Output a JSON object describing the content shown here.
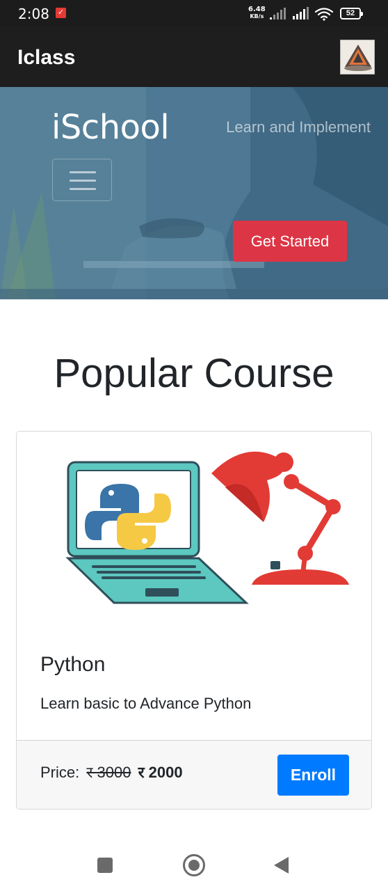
{
  "status_bar": {
    "time": "2:08",
    "net_speed_value": "6.48",
    "net_speed_unit": "KB/s",
    "battery": "52"
  },
  "app_bar": {
    "title": "Iclass"
  },
  "hero": {
    "brand": "iSchool",
    "tagline": "Learn and Implement",
    "cta_label": "Get Started"
  },
  "main": {
    "section_title": "Popular Course",
    "course": {
      "title": "Python",
      "description": "Learn basic to Advance Python",
      "price_label": "Price:",
      "old_price": "र 3000",
      "new_price": "र 2000",
      "enroll_label": "Enroll"
    }
  },
  "colors": {
    "cta": "#dc3545",
    "enroll": "#007bff",
    "app_bar": "#1e1e1e"
  }
}
